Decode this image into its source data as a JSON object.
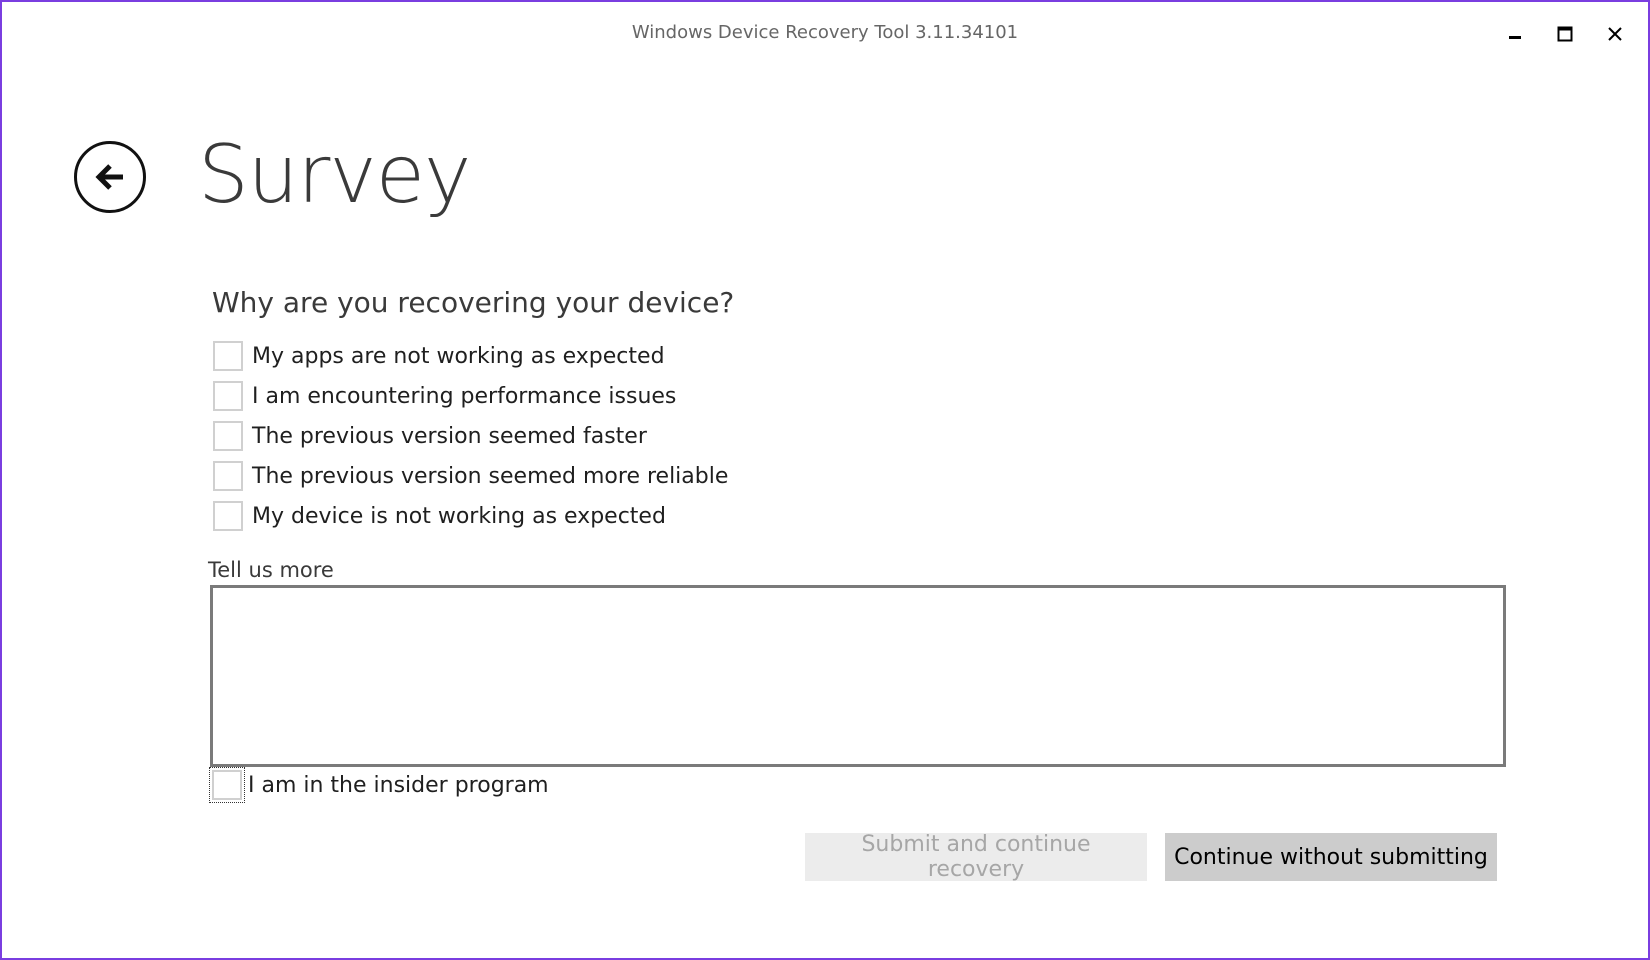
{
  "window": {
    "title": "Windows Device Recovery Tool 3.11.34101",
    "controls": {
      "minimize_icon": "minimize-icon",
      "maximize_icon": "maximize-icon",
      "close_icon": "close-icon"
    }
  },
  "header": {
    "back_icon": "arrow-left-icon",
    "title": "Survey"
  },
  "survey": {
    "question": "Why are you recovering your device?",
    "options": [
      {
        "label": "My apps are not working as expected",
        "checked": false
      },
      {
        "label": "I am encountering performance issues",
        "checked": false
      },
      {
        "label": "The previous version seemed faster",
        "checked": false
      },
      {
        "label": "The previous version seemed more reliable",
        "checked": false
      },
      {
        "label": "My device is not working as expected",
        "checked": false
      }
    ],
    "tell_us_more_label": "Tell us more",
    "tell_us_more_value": "",
    "insider_label": "I am in the insider program",
    "insider_checked": false
  },
  "actions": {
    "submit_label": "Submit and continue recovery",
    "submit_enabled": false,
    "continue_label": "Continue without submitting"
  },
  "colors": {
    "window_border": "#7a3ee0",
    "disabled_button_bg": "#ececec",
    "primary_button_bg": "#cccccc"
  }
}
